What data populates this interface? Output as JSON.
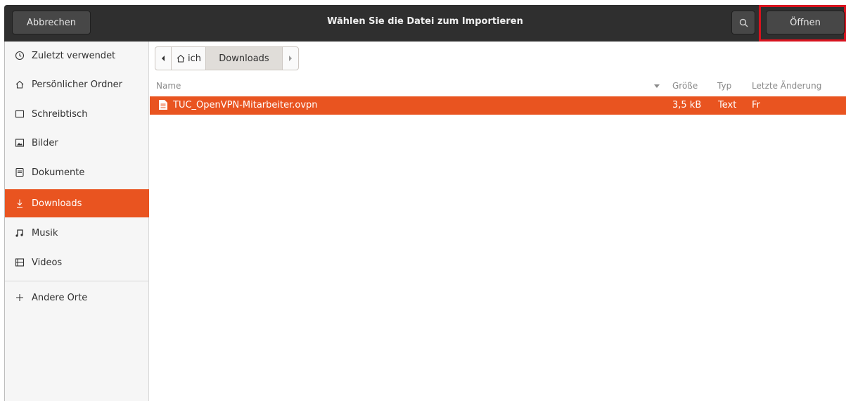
{
  "header": {
    "cancel_label": "Abbrechen",
    "title": "Wählen Sie die Datei zum Importieren",
    "search_icon": "search-icon",
    "open_label": "Öffnen",
    "highlight_color": "#d8131e"
  },
  "sidebar": {
    "items": [
      {
        "label": "Zuletzt verwendet",
        "icon": "clock-icon"
      },
      {
        "label": "Persönlicher Ordner",
        "icon": "home-icon"
      },
      {
        "label": "Schreibtisch",
        "icon": "desktop-icon"
      },
      {
        "label": "Bilder",
        "icon": "pictures-icon"
      },
      {
        "label": "Dokumente",
        "icon": "documents-icon"
      },
      {
        "label": "Downloads",
        "icon": "download-icon",
        "active": true
      },
      {
        "label": "Musik",
        "icon": "music-icon"
      },
      {
        "label": "Videos",
        "icon": "video-icon"
      },
      {
        "label": "Andere Orte",
        "icon": "plus-icon"
      }
    ]
  },
  "pathbar": {
    "back_icon": "chevron-left-icon",
    "home_label": "ich",
    "current_label": "Downloads",
    "forward_icon": "chevron-right-icon"
  },
  "list": {
    "columns": {
      "name": "Name",
      "size": "Größe",
      "type": "Typ",
      "modified": "Letzte Änderung"
    },
    "rows": [
      {
        "name": "TUC_OpenVPN-Mitarbeiter.ovpn",
        "size": "3,5 kB",
        "type": "Text",
        "modified": "Fr",
        "selected": true
      }
    ]
  },
  "colors": {
    "accent": "#e95420",
    "headerbar": "#2f2f2f"
  }
}
